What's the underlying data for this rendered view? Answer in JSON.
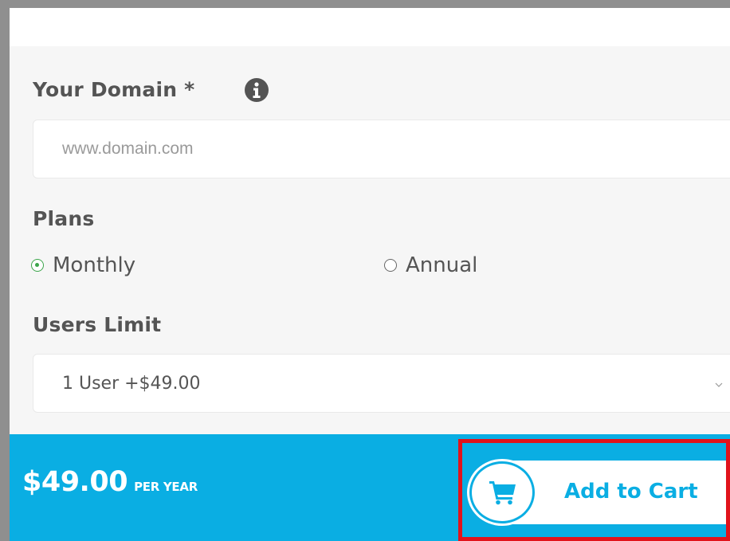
{
  "form": {
    "domain_label": "Your Domain *",
    "domain_placeholder": "www.domain.com",
    "domain_value": "",
    "plans_label": "Plans",
    "plan_options": [
      {
        "label": "Monthly",
        "selected": true
      },
      {
        "label": "Annual",
        "selected": false
      }
    ],
    "users_limit_label": "Users Limit",
    "users_limit_selected": "1 User +$49.00"
  },
  "footer": {
    "price": "$49.00",
    "period": "PER YEAR",
    "cart_button_label": "Add to Cart"
  },
  "colors": {
    "accent": "#0aaee3",
    "selected_radio": "#3ca54b",
    "highlight": "#e1131b",
    "label_text": "#545454"
  },
  "icons": {
    "info": "info-circle-icon",
    "cart": "shopping-cart-icon",
    "dropdown": "chevron-down-icon"
  }
}
